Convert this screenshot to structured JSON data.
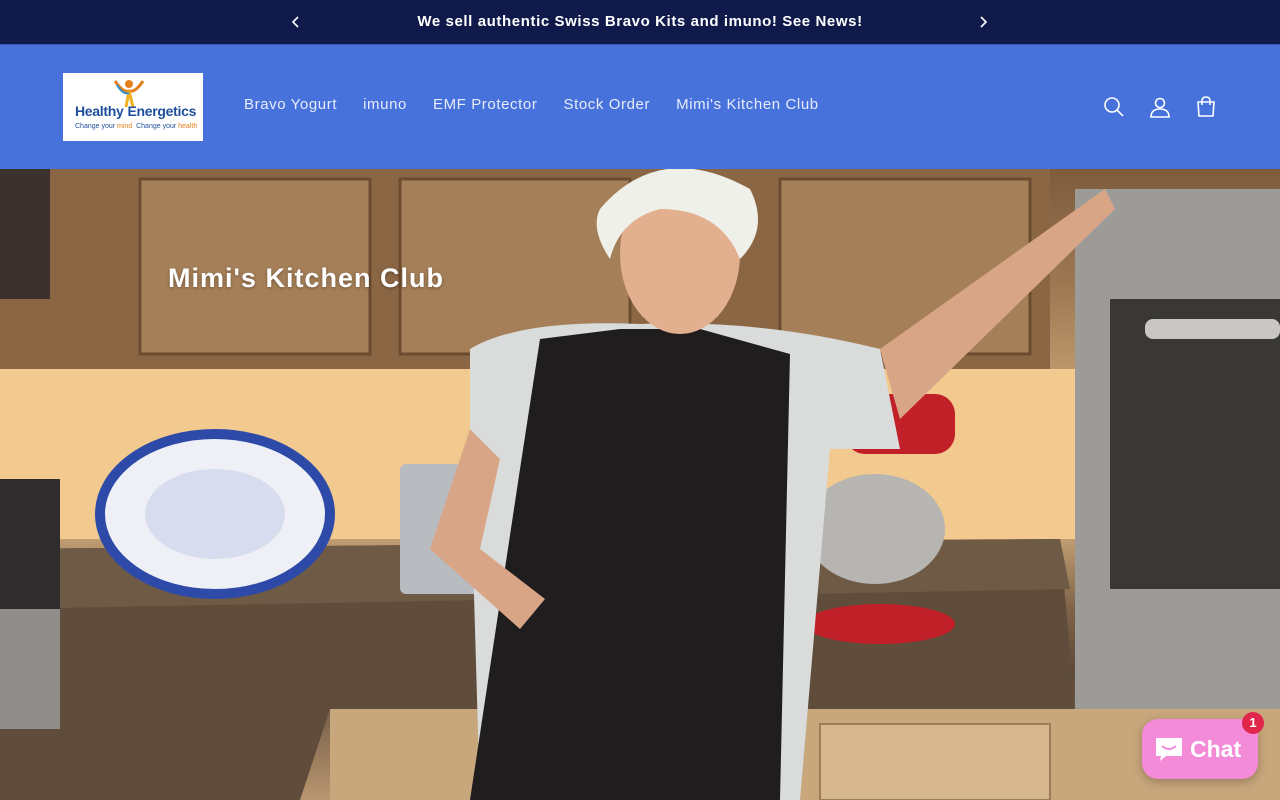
{
  "announcement": {
    "message": "We sell authentic Swiss Bravo Kits and imuno! See News!"
  },
  "header": {
    "logo": {
      "line1a": "Healthy",
      "line1b": "Energetics",
      "line2a": "Change your ",
      "line2b": "mind",
      "line2c": "  Change your ",
      "line2d": "health"
    },
    "nav": [
      {
        "label": "Bravo Yogurt"
      },
      {
        "label": "imuno"
      },
      {
        "label": "EMF Protector"
      },
      {
        "label": "Stock Order"
      },
      {
        "label": "Mimi's Kitchen Club"
      }
    ],
    "icons": [
      "search-icon",
      "account-icon",
      "cart-icon"
    ]
  },
  "hero": {
    "title": "Mimi's Kitchen Club"
  },
  "chat": {
    "label": "Chat",
    "badge": "1"
  },
  "colors": {
    "announcement_bg": "#0f1a4a",
    "header_bg": "#4772dc",
    "chat_bg": "#f38bd8",
    "badge_bg": "#e0264b"
  }
}
